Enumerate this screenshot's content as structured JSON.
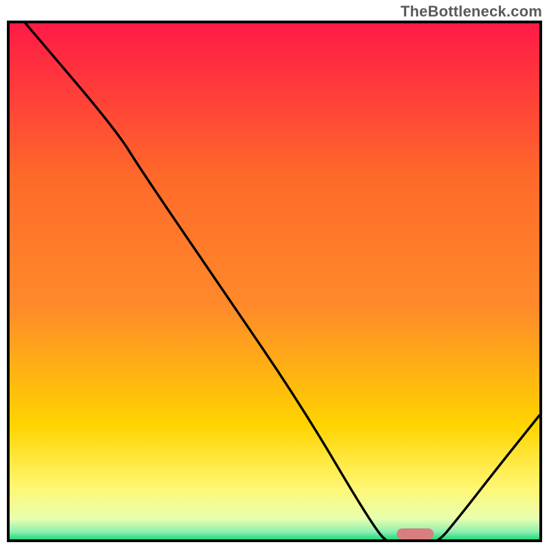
{
  "watermark": "TheBottleneck.com",
  "chart_data": {
    "type": "line",
    "title": "",
    "xlabel": "",
    "ylabel": "",
    "xlim": [
      0,
      100
    ],
    "ylim": [
      0,
      100
    ],
    "curve": [
      {
        "x": 3,
        "y": 100
      },
      {
        "x": 20,
        "y": 80
      },
      {
        "x": 25,
        "y": 72
      },
      {
        "x": 40,
        "y": 50
      },
      {
        "x": 55,
        "y": 28
      },
      {
        "x": 68,
        "y": 6
      },
      {
        "x": 72,
        "y": 1
      },
      {
        "x": 80,
        "y": 1
      },
      {
        "x": 85,
        "y": 7
      },
      {
        "x": 92,
        "y": 16
      },
      {
        "x": 100,
        "y": 26
      }
    ],
    "marker": {
      "x_start": 73,
      "x_end": 80,
      "y": 1
    },
    "background_gradient": {
      "top": "#ff1a46",
      "mid_upper": "#ff8a2a",
      "mid": "#ffd400",
      "mid_lower": "#fff772",
      "near_bottom": "#e8ffb0",
      "bottom": "#21d97d"
    }
  }
}
